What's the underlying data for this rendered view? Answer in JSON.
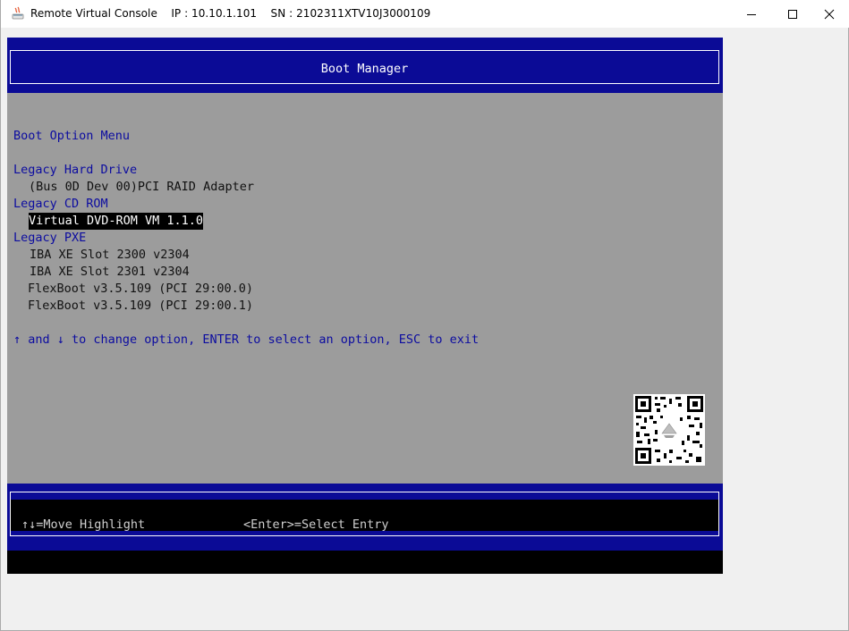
{
  "window": {
    "title": "Remote Virtual Console    IP : 10.10.1.101    SN : 2102311XTV10J3000109",
    "controls": [
      "minimize",
      "maximize",
      "close"
    ]
  },
  "bios": {
    "header_title": "Boot Manager",
    "menu_title": "Boot Option Menu",
    "sections": [
      {
        "label": "Legacy Hard Drive",
        "items": [
          "(Bus 0D Dev 00)PCI RAID Adapter"
        ]
      },
      {
        "label": "Legacy CD ROM",
        "items": [
          "Virtual DVD-ROM VM 1.1.0"
        ],
        "selected_item": "Virtual DVD-ROM VM 1.1.0"
      },
      {
        "label": "Legacy PXE",
        "items": [
          "IBA XE Slot 2300 v2304",
          "IBA XE Slot 2301 v2304",
          "FlexBoot v3.5.109 (PCI 29:00.0)",
          "FlexBoot v3.5.109 (PCI 29:00.1)"
        ]
      }
    ],
    "instructions": "↑ and ↓ to change option, ENTER to select an option, ESC to exit",
    "footer": {
      "move_hint": "↑↓=Move Highlight",
      "select_hint": "<Enter>=Select Entry"
    },
    "qr_icon": "qr-code-icon",
    "colors": {
      "background": "#9c9c9c",
      "header": "#0b0b96",
      "text_blue": "#0c0ca0",
      "highlight_bg": "#000000",
      "highlight_fg": "#ffffff"
    }
  }
}
